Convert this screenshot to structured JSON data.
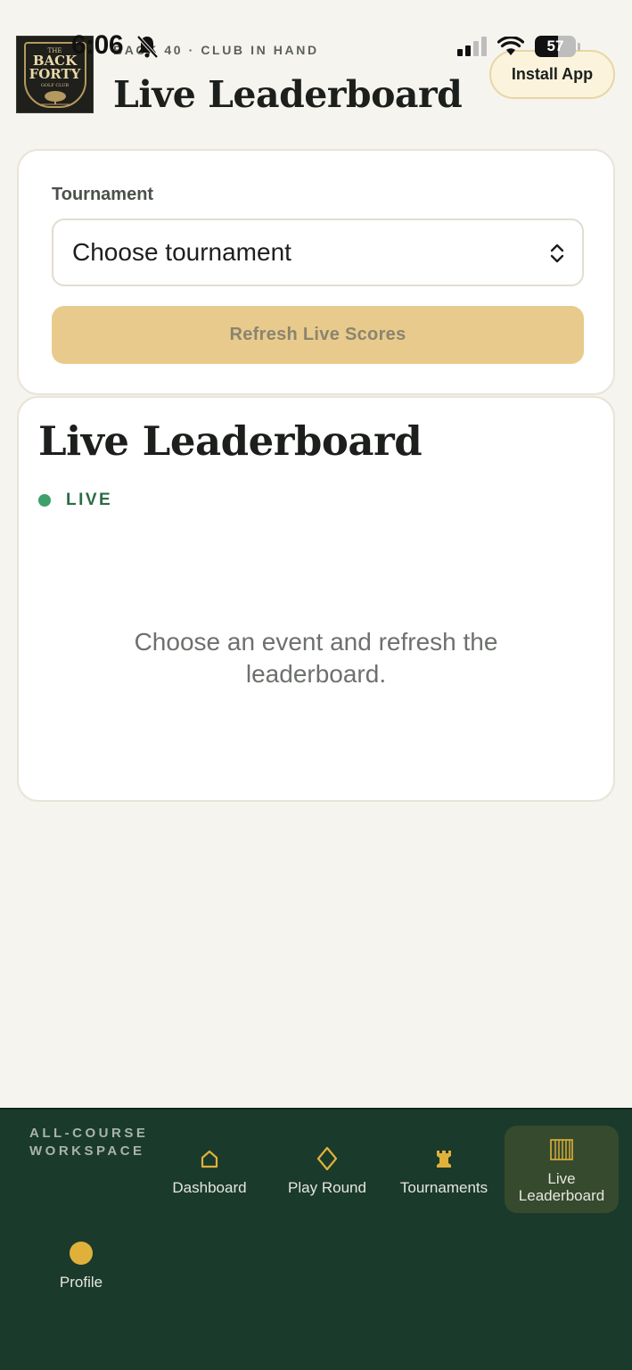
{
  "status_bar": {
    "time": "6:06",
    "battery": "57",
    "battery_level": 0.57
  },
  "header": {
    "logo": {
      "the": "THE",
      "line1": "BACK",
      "line2": "FORTY",
      "line3": "GOLF CLUB"
    },
    "eyebrow": "BACK 40 · CLUB IN HAND",
    "title": "Live Leaderboard",
    "install_label": "Install App"
  },
  "selector_card": {
    "field_label": "Tournament",
    "select_value": "Choose tournament",
    "refresh_label": "Refresh Live Scores"
  },
  "board_card": {
    "title": "Live Leaderboard",
    "live_label": "LIVE",
    "empty_message": "Choose an event and refresh the leaderboard."
  },
  "bottom_nav": {
    "workspace_label": "ALL-COURSE WORKSPACE",
    "items": [
      {
        "label": "Dashboard",
        "icon": "home-icon"
      },
      {
        "label": "Play Round",
        "icon": "diamond-icon"
      },
      {
        "label": "Tournaments",
        "icon": "rook-icon"
      },
      {
        "label": "Live Leaderboard",
        "icon": "bars-icon",
        "active": true
      },
      {
        "label": "Profile",
        "icon": "profile-dot-icon"
      }
    ]
  },
  "colors": {
    "background": "#f6f4ef",
    "accent_gold": "#e0b13a",
    "nav_green": "#1a3a2c",
    "live_green": "#3ea06b",
    "button_disabled": "#e8cb8c"
  }
}
